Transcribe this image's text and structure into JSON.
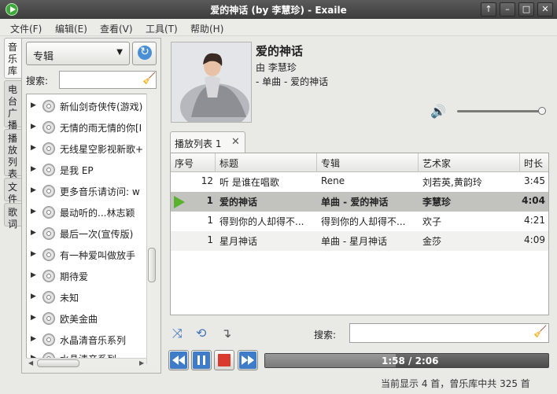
{
  "window": {
    "title": "爱的神话 (by 李慧珍) - Exaile"
  },
  "menu": [
    "文件(F)",
    "编辑(E)",
    "查看(V)",
    "工具(T)",
    "帮助(H)"
  ],
  "side_tabs": [
    "音乐库",
    "电台广播",
    "播放列表",
    "文件",
    "歌词"
  ],
  "library": {
    "view_mode": "专辑",
    "search_label": "搜索:",
    "search_value": "",
    "albums": [
      "新仙剑奇侠传(游戏)",
      "无情的雨无情的你[I",
      "无线星空影视新歌+",
      "是我 EP",
      "更多音乐请访问: w",
      "最动听的...林志颖",
      "最后一次(宣传版)",
      "有一种爱叫做放手",
      "期待爱",
      "未知",
      "欧美金曲",
      "水晶清音乐系列",
      "水晶清音系列"
    ]
  },
  "now_playing": {
    "title": "爱的神话",
    "by_line": "由 李慧珍",
    "album_line": "- 单曲 - 爱的神话",
    "volume": 1.0
  },
  "playlist": {
    "tab_label": "播放列表 1",
    "columns": [
      "序号",
      "标题",
      "专辑",
      "艺术家",
      "时长"
    ],
    "rows": [
      {
        "num": "12",
        "title": "听 是谁在唱歌",
        "album": "Rene",
        "artist": "刘若英,黄韵玲",
        "length": "3:45",
        "playing": false
      },
      {
        "num": "1",
        "title": "爱的神话",
        "album": "单曲 - 爱的神话",
        "artist": "李慧珍",
        "length": "4:04",
        "playing": true
      },
      {
        "num": "1",
        "title": "得到你的人却得不...",
        "album": "得到你的人却得不...",
        "artist": "欢子",
        "length": "4:21",
        "playing": false
      },
      {
        "num": "1",
        "title": "星月神话",
        "album": "单曲 - 星月神话",
        "artist": "金莎",
        "length": "4:09",
        "playing": false
      }
    ],
    "search_label": "搜索:",
    "search_value": ""
  },
  "progress": {
    "elapsed": "1:58",
    "total": "2:06",
    "fraction": 0.46
  },
  "status": "当前显示 4 首，曾乐库中共 325 首",
  "colors": {
    "titlebar": "#4a4a4a",
    "playing_row": "#c2c2be",
    "accent": "#58b22e"
  }
}
